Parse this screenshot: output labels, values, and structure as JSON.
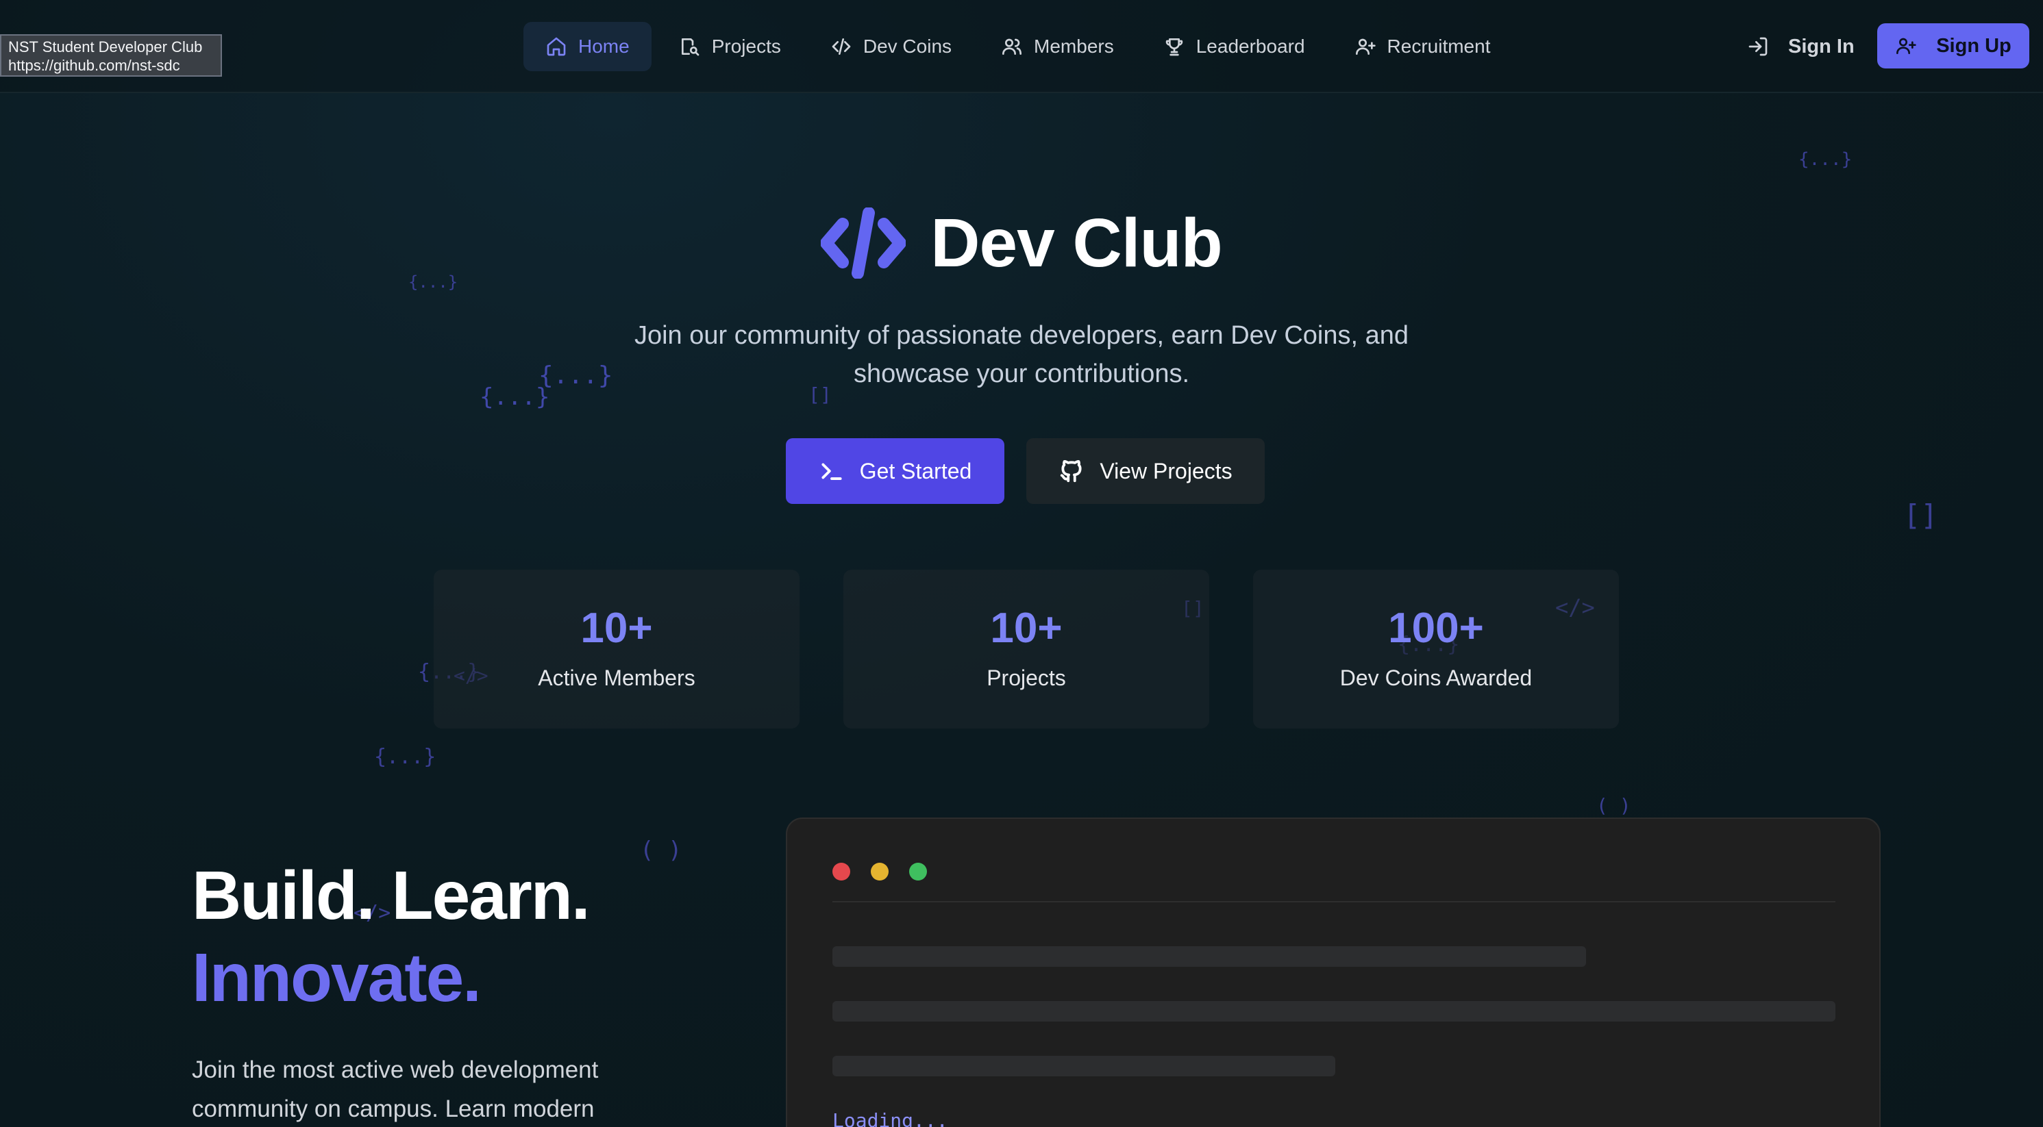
{
  "tooltip": {
    "title": "NST Student Developer Club",
    "url": "https://github.com/nst-sdc"
  },
  "nav": {
    "items": [
      {
        "label": "Home",
        "icon": "home-icon",
        "active": true
      },
      {
        "label": "Projects",
        "icon": "projects-icon",
        "active": false
      },
      {
        "label": "Dev Coins",
        "icon": "code-icon",
        "active": false
      },
      {
        "label": "Members",
        "icon": "users-icon",
        "active": false
      },
      {
        "label": "Leaderboard",
        "icon": "trophy-icon",
        "active": false
      },
      {
        "label": "Recruitment",
        "icon": "user-plus-icon",
        "active": false
      }
    ],
    "sign_in": "Sign In",
    "sign_up": "Sign Up"
  },
  "hero": {
    "title": "Dev Club",
    "subtitle": "Join our community of passionate developers, earn Dev Coins, and showcase your contributions.",
    "primary_button": "Get Started",
    "secondary_button": "View Projects"
  },
  "stats": [
    {
      "value": "10+",
      "label": "Active Members"
    },
    {
      "value": "10+",
      "label": "Projects"
    },
    {
      "value": "100+",
      "label": "Dev Coins Awarded"
    }
  ],
  "lower": {
    "headline_1": "Build. Learn.",
    "headline_2": "Innovate.",
    "body": "Join the most active web development community on campus. Learn modern",
    "terminal_loading": "Loading..."
  },
  "glyphs": {
    "braces": "{...}",
    "brackets": "[]",
    "tag": "</>",
    "parens": "( )"
  },
  "colors": {
    "accent": "#6366f1",
    "accent_text": "#7c83f4",
    "background": "#0c1a20",
    "dot_red": "#e5484d",
    "dot_yellow": "#e5b430",
    "dot_green": "#3fbf5f"
  }
}
